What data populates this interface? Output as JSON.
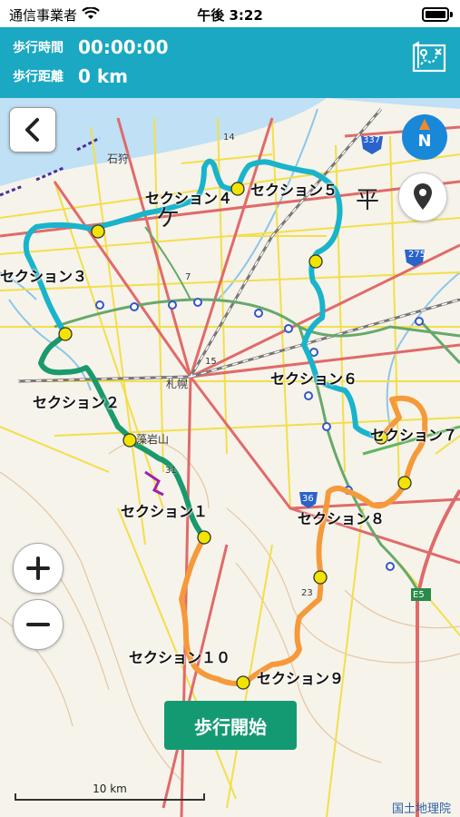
{
  "status_bar": {
    "carrier": "通信事業者",
    "time": "午後 3:22"
  },
  "header": {
    "walk_time_label": "歩行時間",
    "walk_time_value": "00:00:00",
    "walk_distance_label": "歩行距離",
    "walk_distance_value": "0 km"
  },
  "map": {
    "compass_letter": "N",
    "sections": [
      "セクション１",
      "セクション２",
      "セクション３",
      "セクション４",
      "セクション５",
      "セクション６",
      "セクション７",
      "セクション８",
      "セクション９",
      "セクション１０"
    ],
    "place_labels": {
      "ishikari": "石狩",
      "sapporo": "札幌",
      "moiwa": "藻岩山",
      "r14": "14",
      "r7": "7",
      "r15": "15",
      "r23": "23",
      "r31": "31",
      "r36": "36",
      "r275": "275",
      "r337": "337",
      "e5": "E5",
      "big_hei": "平",
      "big_ka": "ケ"
    },
    "scale_label": "10 km",
    "attribution": "国土地理院",
    "route_colors": {
      "cyan": "#19b4cc",
      "green": "#1a9a6c",
      "orange": "#f59a3a",
      "marker": "#f2e400"
    }
  },
  "actions": {
    "start_walk": "歩行開始"
  }
}
